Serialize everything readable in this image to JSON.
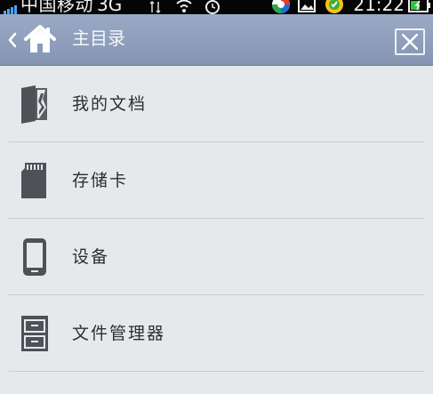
{
  "status_bar": {
    "carrier": "中国移动",
    "network": "3G",
    "time": "21:22"
  },
  "header": {
    "title": "主目录"
  },
  "items": [
    {
      "label": "我的文档",
      "icon": "documents-icon"
    },
    {
      "label": "存储卡",
      "icon": "sd-card-icon"
    },
    {
      "label": "设备",
      "icon": "phone-device-icon"
    },
    {
      "label": "文件管理器",
      "icon": "file-cabinet-icon"
    }
  ],
  "colors": {
    "header": "#8f9fbc",
    "background": "#e6e9ec",
    "icon": "#4e5156",
    "text": "#2e2e2e"
  }
}
